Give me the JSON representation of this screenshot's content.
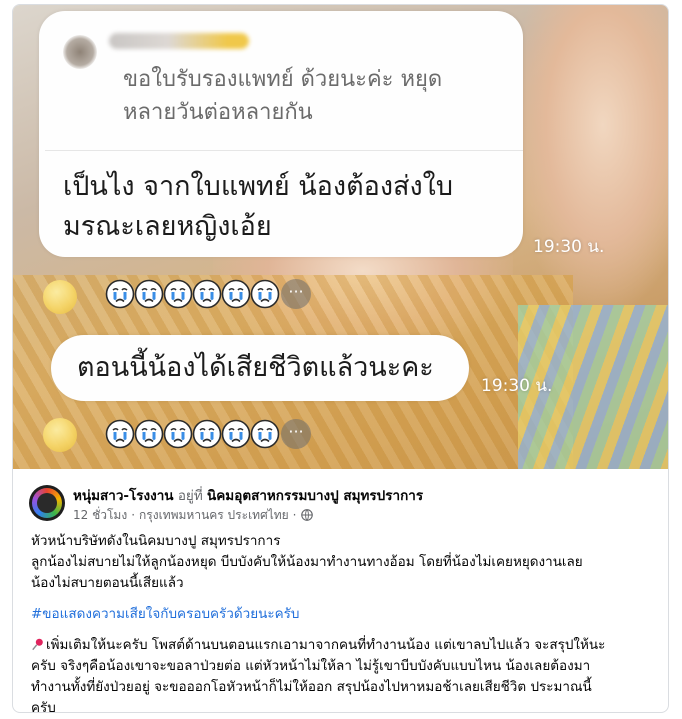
{
  "photo": {
    "quote_text_line1": "ขอใบรับรองแพทย์ ด้วยนะค่ะ หยุด",
    "quote_text_line2": "หลายวันต่อหลายกัน",
    "reply_line1": "เป็นไง จากใบแพทย์ น้องต้องส่งใบ",
    "reply_line2": "มรณะเลยหญิงเอ้ย",
    "time_1": "19:30 น.",
    "time_2": "19:30 น.",
    "second_message": "ตอนนี้น้องได้เสียชีวิตแล้วนะคะ",
    "reactions_more": "···",
    "reaction_icon": "crying-face-icon"
  },
  "post": {
    "page_name": "หนุ่มสาว-โรงงาน",
    "at_word": "อยู่ที่",
    "location": "นิคมอุตสาหกรรมบางปู สมุทรปราการ",
    "time": "12 ชั่วโมง",
    "place": "กรุงเทพมหานคร ประเทศไทย",
    "separator": "·",
    "privacy_icon": "globe-icon",
    "body": {
      "line1": "หัวหน้าบริษัทดังในนิคมบางปู สมุทรปราการ",
      "line2": "ลูกน้องไม่สบายไม่ให้ลูกน้องหยุด บีบบังคับให้น้องมาทำงานทางอ้อม โดยที่น้องไม่เคยหยุดงานเลย",
      "line3": "น้องไม่สบายตอนนี้เสียแล้ว",
      "hashtag": "#ขอแสดงความเสียใจกับครอบครัวด้วยนะครับ",
      "update_line1": "เพิ่มเติมให้นะครับ โพสต์ด้านบนตอนแรกเอามาจากคนที่ทำงานน้อง แต่เขาลบไปแล้ว จะสรุปให้นะ",
      "update_line2": "ครับ จริงๆคือน้องเขาจะขอลาป่วยต่อ แต่หัวหน้าไม่ให้ลา ไม่รู้เขาบีบบังคับแบบไหน น้องเลยต้องมา",
      "update_line3": "ทำงานทั้งที่ยังป่วยอยู่  จะขอออกโอหัวหน้าก็ไม่ให้ออก สรุปน้องไปหาหมอช้าเลยเสียชีวิต ประมาณนี้",
      "update_line4": "ครับ"
    }
  },
  "colors": {
    "hashtag": "#216fdb",
    "muted": "#65676b",
    "border": "#dadde1"
  }
}
